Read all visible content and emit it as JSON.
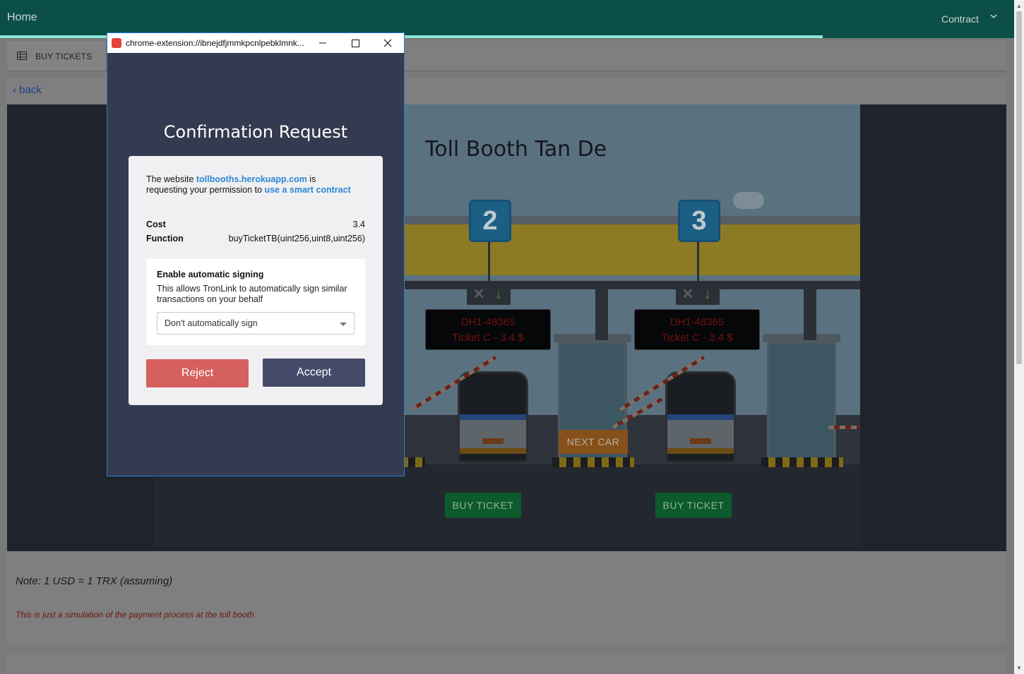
{
  "navbar": {
    "home": "Home",
    "contract": "Contract"
  },
  "tabs": {
    "buy_tickets": "BUY TICKETS",
    "back": "back"
  },
  "scene": {
    "title": "Toll Booth Tan De",
    "lanes": [
      {
        "number": "2",
        "plate": "DH1-48365",
        "ticket": "Ticket C - 3.4 $",
        "button": "BUY TICKET"
      },
      {
        "number": "3",
        "plate": "DH1-48365",
        "ticket": "Ticket C - 3.4 $",
        "button": "BUY TICKET"
      }
    ],
    "next_car": "NEXT CAR"
  },
  "notes": {
    "rate": "Note: 1 USD = 1 TRX (assuming)",
    "disclaimer": "This is just a simulation of the payment process at the toll booth"
  },
  "popup": {
    "url": "chrome-extension://ibnejdfjmmkpcnlpebklmnk...",
    "title": "Confirmation Request",
    "req_prefix": "The website ",
    "site": "tollbooths.herokuapp.com",
    "req_mid": " is requesting your permission to ",
    "action": "use a smart contract",
    "cost_label": "Cost",
    "cost_value": "3.4",
    "function_label": "Function",
    "function_value": "buyTicketTB(uint256,uint8,uint256)",
    "auto_title": "Enable automatic signing",
    "auto_desc": "This allows TronLink to automatically sign similar transactions on your behalf",
    "select_value": "Don't automatically sign",
    "reject": "Reject",
    "accept": "Accept"
  },
  "colors": {
    "navbar": "#0c4e48",
    "accent_line": "#8ee6da",
    "popup_bg": "#343a4f",
    "link": "#2b86d6",
    "reject": "#d6605e",
    "accept": "#444b6a",
    "buy_button": "#0d5a2c"
  }
}
